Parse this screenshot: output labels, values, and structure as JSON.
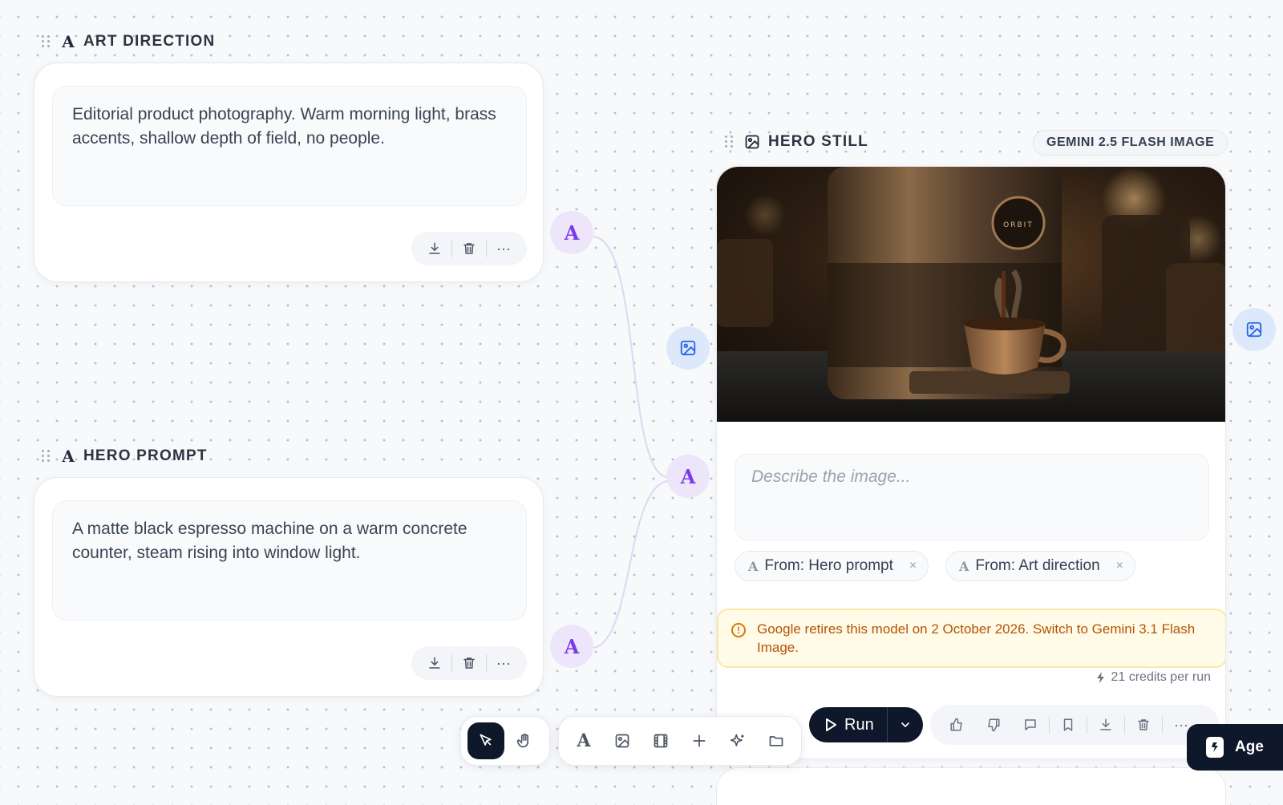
{
  "nodes": {
    "art_direction": {
      "title": "ART DIRECTION",
      "text": "Editorial product photography. Warm morning light, brass accents, shallow depth of field, no people."
    },
    "hero_prompt": {
      "title": "HERO PROMPT",
      "text": "A matte black espresso machine on a warm concrete counter, steam rising into window light."
    },
    "hero_still": {
      "title": "HERO STILL",
      "model": "GEMINI 2.5 FLASH IMAGE",
      "image_brand": "ORBIT",
      "prompt_placeholder": "Describe the image...",
      "chips": [
        {
          "label": "From: Hero prompt"
        },
        {
          "label": "From: Art direction"
        }
      ],
      "warning": "Google retires this model on 2 October 2026. Switch to Gemini 3.1 Flash Image.",
      "credits": "21 credits per run",
      "run_label": "Run"
    }
  },
  "glyphs": {
    "text_type": "A",
    "warning": "!",
    "close": "×",
    "more": "···"
  },
  "agent_button": {
    "label": "Age"
  },
  "icons": {
    "download": "download-icon",
    "delete": "trash-icon",
    "more": "more-icon",
    "image": "image-icon",
    "video": "film-icon",
    "add": "plus-icon",
    "ai": "sparkles-icon",
    "folder": "folder-icon",
    "select": "cursor-icon",
    "pan": "hand-icon"
  },
  "colors": {
    "text_port": "#7c3aed",
    "image_port": "#2563eb",
    "warning_text": "#b45309",
    "run_button": "#0f172a"
  }
}
